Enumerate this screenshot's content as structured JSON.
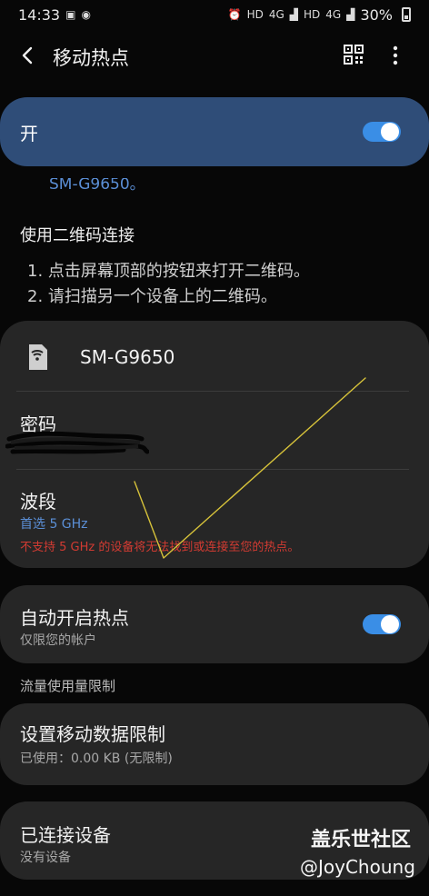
{
  "status_bar": {
    "time": "14:33",
    "signal_1": "HD",
    "signal_2": "HD",
    "net_1": "4G",
    "net_2": "4G",
    "battery": "30%"
  },
  "header": {
    "title": "移动热点",
    "back_icon": "back-arrow-icon",
    "qr_icon": "qr-code-icon",
    "more_icon": "more-vertical-icon"
  },
  "master_switch": {
    "label": "开",
    "state": "on",
    "accent": "#3a8ee6"
  },
  "ssid_peek": "SM-G9650。",
  "qr_connect": {
    "title": "使用二维码连接",
    "steps": [
      "1. 点击屏幕顶部的按钮来打开二维码。",
      "2. 请扫描另一个设备上的二维码。"
    ]
  },
  "network_card": {
    "device_name": "SM-G9650",
    "password_label": "密码",
    "band_label": "波段",
    "band_value": "首选 5 GHz",
    "band_warning": "不支持 5 GHz 的设备将无法找到或连接至您的热点。"
  },
  "auto_hotspot": {
    "title": "自动开启热点",
    "subtitle": "仅限您的帐户",
    "state": "on"
  },
  "data_limit": {
    "section_label": "流量使用量限制",
    "title": "设置移动数据限制",
    "subtitle": "已使用：0.00 KB (无限制)"
  },
  "connected_devices": {
    "title": "已连接设备",
    "subtitle": "没有设备"
  },
  "watermark": {
    "main": "盖乐世社区",
    "sub": "@JoyChoung"
  },
  "colors": {
    "background": "#070707",
    "card": "#262626",
    "master_card": "#2f4d78",
    "link_blue": "#5b8fd6",
    "warning_red": "#d23b32",
    "annotation_yellow": "#d6c23a"
  }
}
